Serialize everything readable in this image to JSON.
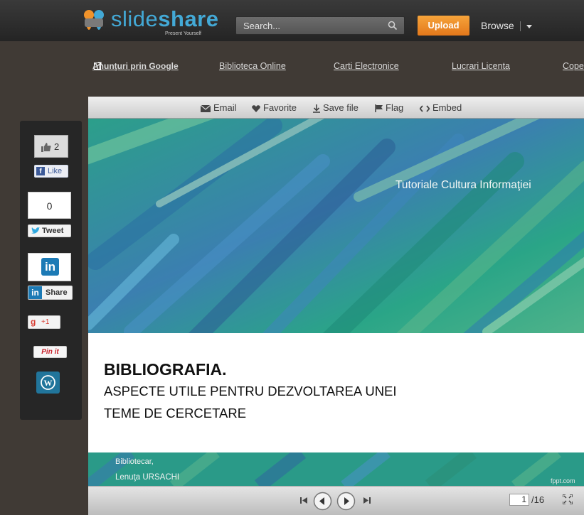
{
  "header": {
    "logo_text_light": "slide",
    "logo_text_bold": "share",
    "logo_tagline": "Present Yourself",
    "search_placeholder": "Search...",
    "upload_label": "Upload",
    "browse_label": "Browse"
  },
  "ads": {
    "google_label": "Anunţuri prin Google",
    "links": [
      "Biblioteca Online",
      "Carti Electronice",
      "Lucrari Licenta",
      "Cope"
    ]
  },
  "toolbar": {
    "email": "Email",
    "favorite": "Favorite",
    "save": "Save file",
    "flag": "Flag",
    "embed": "Embed"
  },
  "slide": {
    "subtitle": "Tutoriale Cultura Informaţiei",
    "title": "BIBLIOGRAFIA.",
    "line1": "ASPECTE UTILE PENTRU DEZVOLTAREA UNEI",
    "line2": "TEME DE CERCETARE",
    "author_role": "Bibliotecar,",
    "author_name": "Lenuţa URSACHI",
    "credit": "fppt.com"
  },
  "controls": {
    "current_page": "1",
    "total_pages": "/16"
  },
  "share": {
    "like_count": "2",
    "like_label": "Like",
    "tweet_count": "0",
    "tweet_label": "Tweet",
    "linkedin_label": "Share",
    "plusone_label": "+1",
    "pinit_label": "Pin it"
  },
  "colors": {
    "upload": "#f0922b",
    "logo_blue": "#43a9d6",
    "facebook": "#3b5998",
    "twitter": "#2fa9e0",
    "linkedin": "#1c7ab5",
    "wordpress": "#21759b",
    "pinterest": "#c8232c"
  }
}
